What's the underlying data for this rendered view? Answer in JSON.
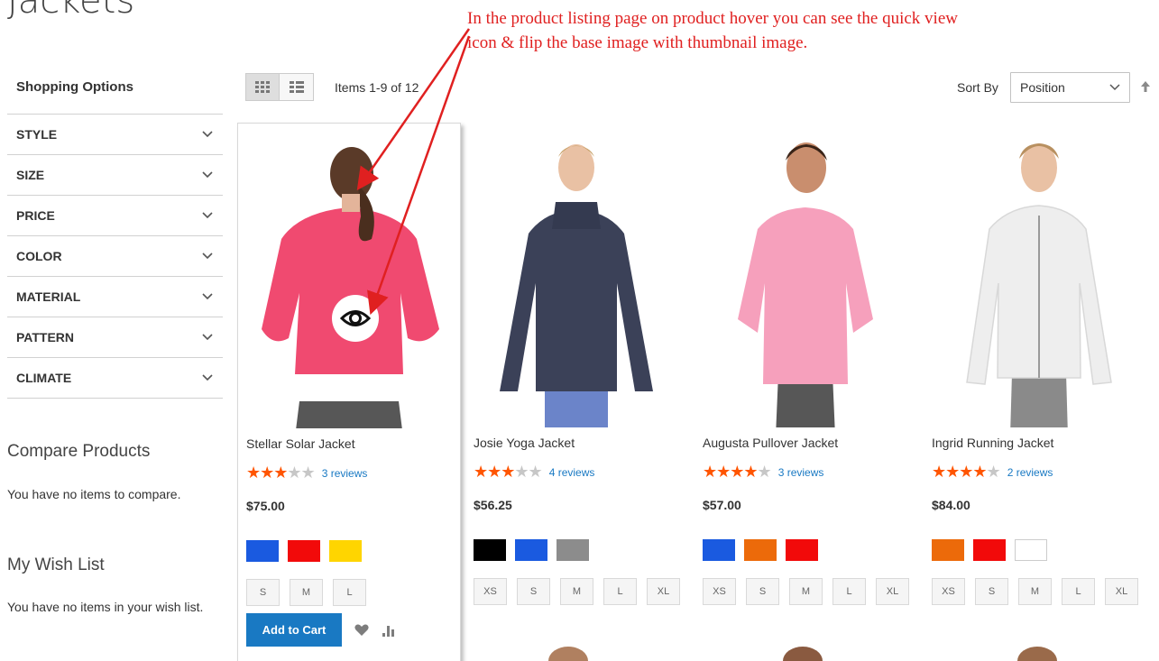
{
  "page": {
    "title": "Jackets"
  },
  "annotation": {
    "line1": "In the product listing page on product hover you can see the quick view",
    "line2": "icon & flip the base image with thumbnail image."
  },
  "sidebar": {
    "title": "Shopping Options",
    "filters": [
      "STYLE",
      "SIZE",
      "PRICE",
      "COLOR",
      "MATERIAL",
      "PATTERN",
      "CLIMATE"
    ],
    "compare": {
      "title": "Compare Products",
      "text": "You have no items to compare."
    },
    "wishlist": {
      "title": "My Wish List",
      "text": "You have no items in your wish list."
    }
  },
  "toolbar": {
    "items_count": "Items 1-9 of 12",
    "sort_label": "Sort By",
    "sort_value": "Position"
  },
  "products": [
    {
      "name": "Stellar Solar Jacket",
      "rating": 3,
      "reviews": "3 reviews",
      "price": "$75.00",
      "colors": [
        "#1a5ae0",
        "#f20a0a",
        "#ffd500"
      ],
      "sizes": [
        "S",
        "M",
        "L"
      ],
      "add_to_cart": "Add to Cart",
      "shirt_color": "#f04a70"
    },
    {
      "name": "Josie Yoga Jacket",
      "rating": 3,
      "reviews": "4 reviews",
      "price": "$56.25",
      "colors": [
        "#000000",
        "#1a5ae0",
        "#8c8c8c"
      ],
      "sizes": [
        "XS",
        "S",
        "M",
        "L",
        "XL"
      ],
      "shirt_color": "#3b4158"
    },
    {
      "name": "Augusta Pullover Jacket",
      "rating": 4,
      "reviews": "3 reviews",
      "price": "$57.00",
      "colors": [
        "#1a5ae0",
        "#ec6a0a",
        "#f20a0a"
      ],
      "sizes": [
        "XS",
        "S",
        "M",
        "L",
        "XL"
      ],
      "shirt_color": "#f6a0bc"
    },
    {
      "name": "Ingrid Running Jacket",
      "rating": 4,
      "reviews": "2 reviews",
      "price": "$84.00",
      "colors": [
        "#ec6a0a",
        "#f20a0a",
        "#ffffff"
      ],
      "sizes": [
        "XS",
        "S",
        "M",
        "L",
        "XL"
      ],
      "shirt_color": "#eeeeee"
    }
  ]
}
